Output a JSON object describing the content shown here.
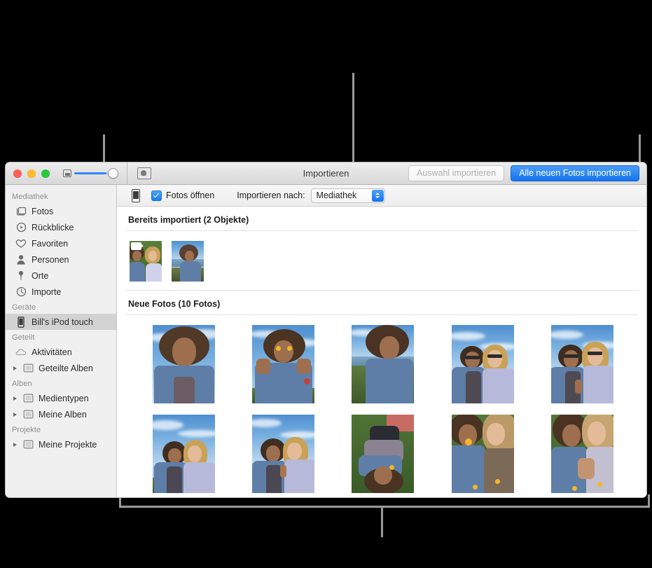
{
  "window": {
    "title": "Importieren",
    "traffic_lights": [
      "close",
      "minimize",
      "zoom"
    ],
    "toolbar": {
      "zoom_slider_label_small": "small-thumbnail-icon",
      "zoom_slider_label_large": "large-thumbnail-icon",
      "info_button": "info-icon",
      "import_selection_label": "Auswahl importieren",
      "import_selection_enabled": false,
      "import_all_label": "Alle neuen Fotos importieren",
      "accent_color": "#1574ee"
    }
  },
  "import_bar": {
    "device_icon": "ipod-touch-icon",
    "open_photos_checkbox": {
      "label": "Fotos öffnen",
      "checked": true
    },
    "import_to_label": "Importieren nach:",
    "import_to_value": "Mediathek"
  },
  "sidebar": {
    "groups": [
      {
        "header": "Mediathek",
        "items": [
          {
            "label": "Fotos",
            "icon": "photos-icon",
            "disclosure": false,
            "selected": false
          },
          {
            "label": "Rückblicke",
            "icon": "memories-icon",
            "disclosure": false,
            "selected": false
          },
          {
            "label": "Favoriten",
            "icon": "heart-icon",
            "disclosure": false,
            "selected": false
          },
          {
            "label": "Personen",
            "icon": "person-icon",
            "disclosure": false,
            "selected": false
          },
          {
            "label": "Orte",
            "icon": "pin-icon",
            "disclosure": false,
            "selected": false
          },
          {
            "label": "Importe",
            "icon": "clock-icon",
            "disclosure": false,
            "selected": false
          }
        ]
      },
      {
        "header": "Geräte",
        "items": [
          {
            "label": "Bill's iPod touch",
            "icon": "ipod-icon",
            "disclosure": false,
            "selected": true
          }
        ]
      },
      {
        "header": "Geteilt",
        "items": [
          {
            "label": "Aktivitäten",
            "icon": "cloud-icon",
            "disclosure": false,
            "selected": false
          },
          {
            "label": "Geteilte Alben",
            "icon": "album-icon",
            "disclosure": true,
            "selected": false
          }
        ]
      },
      {
        "header": "Alben",
        "items": [
          {
            "label": "Medientypen",
            "icon": "album-icon",
            "disclosure": true,
            "selected": false
          },
          {
            "label": "Meine Alben",
            "icon": "album-icon",
            "disclosure": true,
            "selected": false
          }
        ]
      },
      {
        "header": "Projekte",
        "items": [
          {
            "label": "Meine Projekte",
            "icon": "album-icon",
            "disclosure": true,
            "selected": false
          }
        ]
      }
    ]
  },
  "main": {
    "sections": [
      {
        "title": "Bereits importiert (2 Objekte)",
        "count": 2,
        "items": [
          {
            "caption": "two-girls-lying-grass",
            "is_video": true
          },
          {
            "caption": "girl-by-the-sea",
            "is_video": false
          }
        ]
      },
      {
        "title": "Neue Fotos (10 Fotos)",
        "count": 10,
        "items": [
          {
            "caption": "girl-looking-up",
            "is_video": false
          },
          {
            "caption": "girl-flowers-over-eyes",
            "is_video": false
          },
          {
            "caption": "girl-sitting-grass",
            "is_video": false
          },
          {
            "caption": "two-girls-sunglasses",
            "is_video": false
          },
          {
            "caption": "two-girls-sunglasses-peace",
            "is_video": false
          },
          {
            "caption": "two-girls-standing-sky",
            "is_video": false
          },
          {
            "caption": "two-girls-peace-sign",
            "is_video": false
          },
          {
            "caption": "girl-upside-down-grass",
            "is_video": false
          },
          {
            "caption": "two-girls-lying-flower",
            "is_video": false
          },
          {
            "caption": "two-girls-lying-close",
            "is_video": false
          }
        ]
      }
    ]
  },
  "callouts": [
    {
      "name": "sidebar-callout",
      "orientation": "vertical-left"
    },
    {
      "name": "import-to-callout",
      "orientation": "vertical-top"
    },
    {
      "name": "import-all-callout",
      "orientation": "vertical-top-right"
    },
    {
      "name": "already-imported-bracket",
      "orientation": "bracket-left"
    },
    {
      "name": "new-photos-bracket",
      "orientation": "bracket-bottom"
    }
  ]
}
